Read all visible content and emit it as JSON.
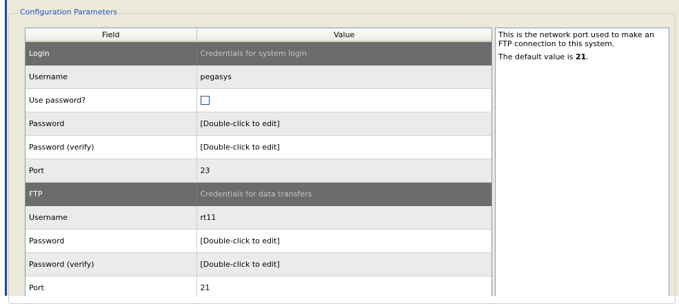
{
  "group": {
    "title": "Configuration Parameters"
  },
  "table": {
    "columns": [
      "Field",
      "Value"
    ],
    "rows": [
      {
        "type": "section",
        "field": "Login",
        "value": "Credentials for system login"
      },
      {
        "type": "row",
        "field": "Username",
        "value": "pegasys"
      },
      {
        "type": "checkbox",
        "field": "Use password?",
        "checked": false
      },
      {
        "type": "row",
        "field": "Password",
        "value": "[Double-click to edit]"
      },
      {
        "type": "row",
        "field": "Password (verify)",
        "value": "[Double-click to edit]"
      },
      {
        "type": "row",
        "field": "Port",
        "value": "23"
      },
      {
        "type": "section",
        "field": "FTP",
        "value": "Credentials for data transfers"
      },
      {
        "type": "row",
        "field": "Username",
        "value": "rt11"
      },
      {
        "type": "row",
        "field": "Password",
        "value": "[Double-click to edit]"
      },
      {
        "type": "row",
        "field": "Password (verify)",
        "value": "[Double-click to edit]"
      },
      {
        "type": "row",
        "field": "Port",
        "value": "21"
      }
    ]
  },
  "help": {
    "description": "This is the network port used to make an FTP connection to this system.",
    "default_prefix": "The default value is ",
    "default_value": "21",
    "default_suffix": "."
  },
  "colors": {
    "accent_bar": "#1f3fae",
    "section_row": "#6c6c6c",
    "legend_text": "#2151c5"
  }
}
